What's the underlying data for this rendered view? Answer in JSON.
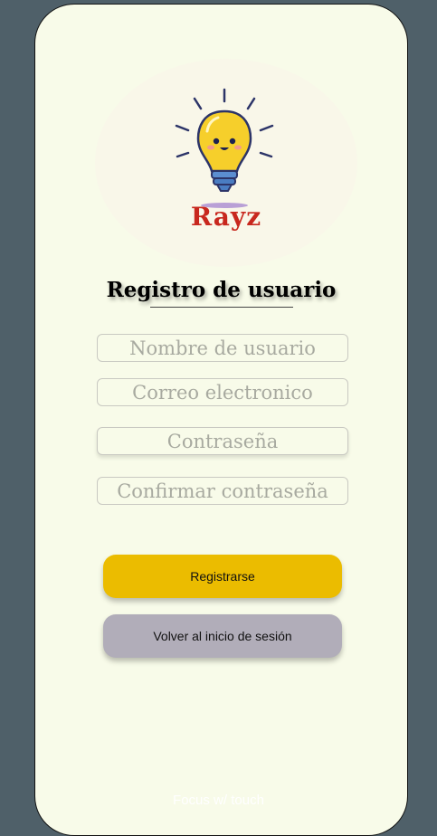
{
  "app": {
    "logo_text": "Rayz"
  },
  "form": {
    "title": "Registro de usuario",
    "fields": {
      "username_placeholder": "Nombre de usuario",
      "email_placeholder": "Correo electronico",
      "password_placeholder": "Contraseña",
      "confirm_placeholder": "Confirmar contraseña"
    }
  },
  "buttons": {
    "register_label": "Registrarse",
    "back_label": "Volver al inicio de sesión"
  },
  "footer": {
    "text": "Focus w/ touch"
  },
  "colors": {
    "background": "#4f6069",
    "screen": "#f8fbe9",
    "primary_button": "#ebbc00",
    "secondary_button": "#b1adb9",
    "logo_text": "#c8281e"
  },
  "icons": {
    "logo": "lightbulb-icon"
  }
}
